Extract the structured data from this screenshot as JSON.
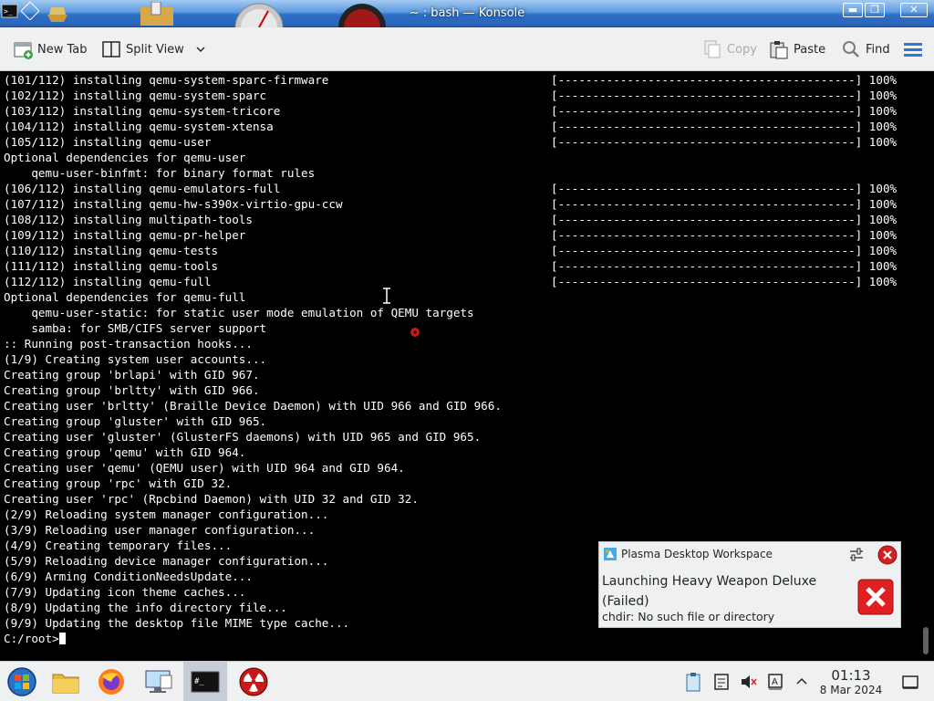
{
  "window": {
    "title": "~ : bash — Konsole"
  },
  "toolbar": {
    "new_tab": "New Tab",
    "split_view": "Split View",
    "copy": "Copy",
    "paste": "Paste",
    "find": "Find"
  },
  "terminal": {
    "lines": [
      "(101/112) installing qemu-system-sparc-firmware",
      "(102/112) installing qemu-system-sparc",
      "(103/112) installing qemu-system-tricore",
      "(104/112) installing qemu-system-xtensa",
      "(105/112) installing qemu-user",
      "Optional dependencies for qemu-user",
      "    qemu-user-binfmt: for binary format rules",
      "(106/112) installing qemu-emulators-full",
      "(107/112) installing qemu-hw-s390x-virtio-gpu-ccw",
      "(108/112) installing multipath-tools",
      "(109/112) installing qemu-pr-helper",
      "(110/112) installing qemu-tests",
      "(111/112) installing qemu-tools",
      "(112/112) installing qemu-full",
      "Optional dependencies for qemu-full",
      "    qemu-user-static: for static user mode emulation of QEMU targets",
      "    samba: for SMB/CIFS server support",
      ":: Running post-transaction hooks...",
      "(1/9) Creating system user accounts...",
      "Creating group 'brlapi' with GID 967.",
      "Creating group 'brltty' with GID 966.",
      "Creating user 'brltty' (Braille Device Daemon) with UID 966 and GID 966.",
      "Creating group 'gluster' with GID 965.",
      "Creating user 'gluster' (GlusterFS daemons) with UID 965 and GID 965.",
      "Creating group 'qemu' with GID 964.",
      "Creating user 'qemu' (QEMU user) with UID 964 and GID 964.",
      "Creating group 'rpc' with GID 32.",
      "Creating user 'rpc' (Rpcbind Daemon) with UID 32 and GID 32.",
      "(2/9) Reloading system manager configuration...",
      "(3/9) Reloading user manager configuration...",
      "(4/9) Creating temporary files...",
      "(5/9) Reloading device manager configuration...",
      "(6/9) Arming ConditionNeedsUpdate...",
      "(7/9) Updating icon theme caches...",
      "(8/9) Updating the info directory file...",
      "(9/9) Updating the desktop file MIME type cache..."
    ],
    "progress": "[-------------------------------------------] 100%",
    "prompt": "C:/root>"
  },
  "notification": {
    "app": "Plasma Desktop Workspace",
    "title": "Launching Heavy Weapon Deluxe (Failed)",
    "body": "chdir: No such file or directory"
  },
  "taskbar": {
    "time": "01:13",
    "date": "8 Mar 2024"
  },
  "colors": {
    "terminal_bg": "#000000",
    "terminal_fg": "#ffffff",
    "titlebar": "#2d70c8",
    "panel": "#eff0f1",
    "error_red": "#d42020",
    "accent_blue": "#3daee9"
  }
}
